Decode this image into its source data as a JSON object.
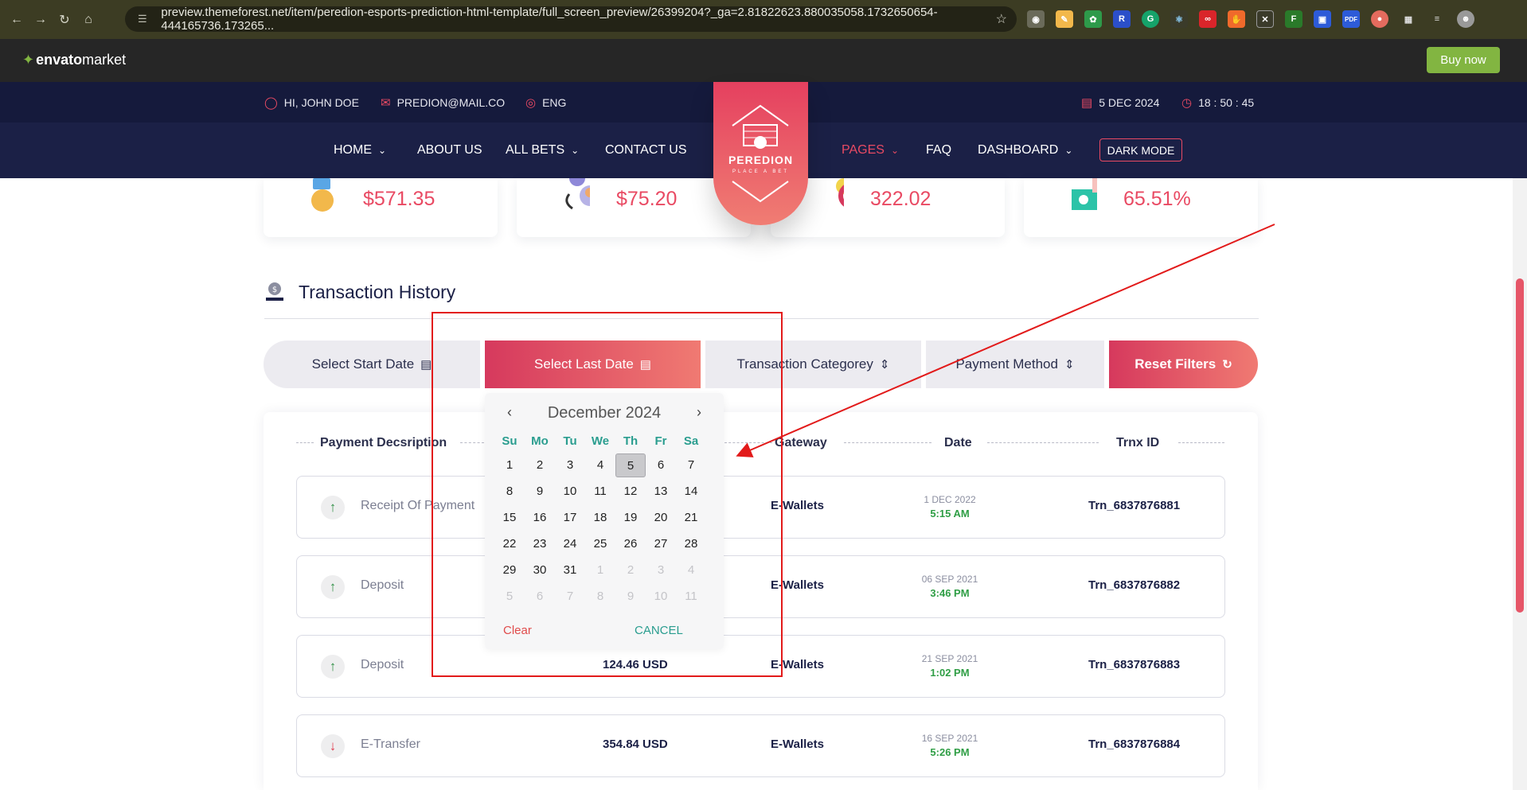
{
  "browser": {
    "url": "preview.themeforest.net/item/peredion-esports-prediction-html-template/full_screen_preview/26399204?_ga=2.81822623.880035058.1732650654-444165736.173265..."
  },
  "envato": {
    "logo": "envato",
    "logo_suffix": "market",
    "buy": "Buy now"
  },
  "topbar": {
    "user": "HI, JOHN DOE",
    "email": "PREDION@MAIL.CO",
    "lang": "ENG",
    "date": "5 DEC 2024",
    "time": "18 : 50 : 45"
  },
  "nav": {
    "home": "HOME",
    "about": "ABOUT US",
    "bets": "ALL BETS",
    "contact": "CONTACT US",
    "pages": "PAGES",
    "faq": "FAQ",
    "dashboard": "DASHBOARD",
    "dark": "DARK MODE"
  },
  "brand": {
    "name": "PEREDION",
    "tagline": "PLACE A BET"
  },
  "stats": [
    "$571.35",
    "$75.20",
    "322.02",
    "65.51%"
  ],
  "history": {
    "title": "Transaction History",
    "filters": {
      "start": "Select Start Date",
      "last": "Select Last Date",
      "category": "Transaction Categorey",
      "method": "Payment Method",
      "reset": "Reset Filters"
    },
    "columns": {
      "desc": "Payment Decsription",
      "gateway": "Gateway",
      "date": "Date",
      "trnx": "Trnx ID"
    },
    "rows": [
      {
        "desc": "Receipt Of Payment",
        "amount": "",
        "gateway": "E-Wallets",
        "date": "1 DEC 2022",
        "time": "5:15 AM",
        "trnx": "Trn_6837876881",
        "dir": "up"
      },
      {
        "desc": "Deposit",
        "amount": "",
        "gateway": "E-Wallets",
        "date": "06 SEP 2021",
        "time": "3:46 PM",
        "trnx": "Trn_6837876882",
        "dir": "up"
      },
      {
        "desc": "Deposit",
        "amount": "124.46 USD",
        "gateway": "E-Wallets",
        "date": "21 SEP 2021",
        "time": "1:02 PM",
        "trnx": "Trn_6837876883",
        "dir": "up"
      },
      {
        "desc": "E-Transfer",
        "amount": "354.84 USD",
        "gateway": "E-Wallets",
        "date": "16 SEP 2021",
        "time": "5:26 PM",
        "trnx": "Trn_6837876884",
        "dir": "down"
      }
    ]
  },
  "picker": {
    "month": "December 2024",
    "weekdays": [
      "Su",
      "Mo",
      "Tu",
      "We",
      "Th",
      "Fr",
      "Sa"
    ],
    "days": [
      [
        "1",
        "2",
        "3",
        "4",
        "5",
        "6",
        "7"
      ],
      [
        "8",
        "9",
        "10",
        "11",
        "12",
        "13",
        "14"
      ],
      [
        "15",
        "16",
        "17",
        "18",
        "19",
        "20",
        "21"
      ],
      [
        "22",
        "23",
        "24",
        "25",
        "26",
        "27",
        "28"
      ],
      [
        "29",
        "30",
        "31",
        "1",
        "2",
        "3",
        "4"
      ],
      [
        "5",
        "6",
        "7",
        "8",
        "9",
        "10",
        "11"
      ]
    ],
    "selected": "5",
    "clear": "Clear",
    "cancel": "CANCEL"
  },
  "colors": {
    "accent": "#e94a63",
    "navy": "#1b2046",
    "teal": "#2a9d8f",
    "envato_green": "#82b541"
  }
}
